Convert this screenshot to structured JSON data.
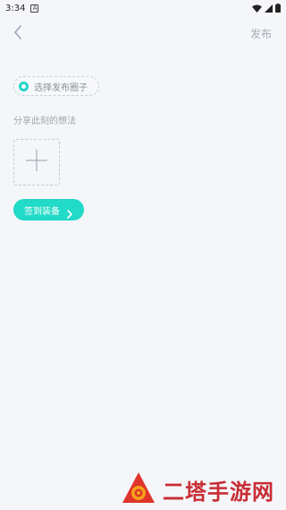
{
  "status_bar": {
    "time": "3:34",
    "notification_icon": "A",
    "icons": [
      "wifi-icon",
      "signal-icon",
      "battery-icon"
    ]
  },
  "header": {
    "back_icon": "chevron-left-icon",
    "publish_label": "发布"
  },
  "circle_select": {
    "label": "选择发布圈子"
  },
  "thoughts": {
    "placeholder": "分享此刻的想法"
  },
  "add_image": {
    "icon": "plus-icon"
  },
  "sign_button": {
    "label": "签到装备",
    "icon": "chevron-right-icon"
  },
  "watermark": {
    "text": "二塔手游网"
  },
  "colors": {
    "accent": "#21dac7",
    "background": "#f4f6fa",
    "muted_text": "#a0a6af",
    "watermark": "#c82d34"
  }
}
